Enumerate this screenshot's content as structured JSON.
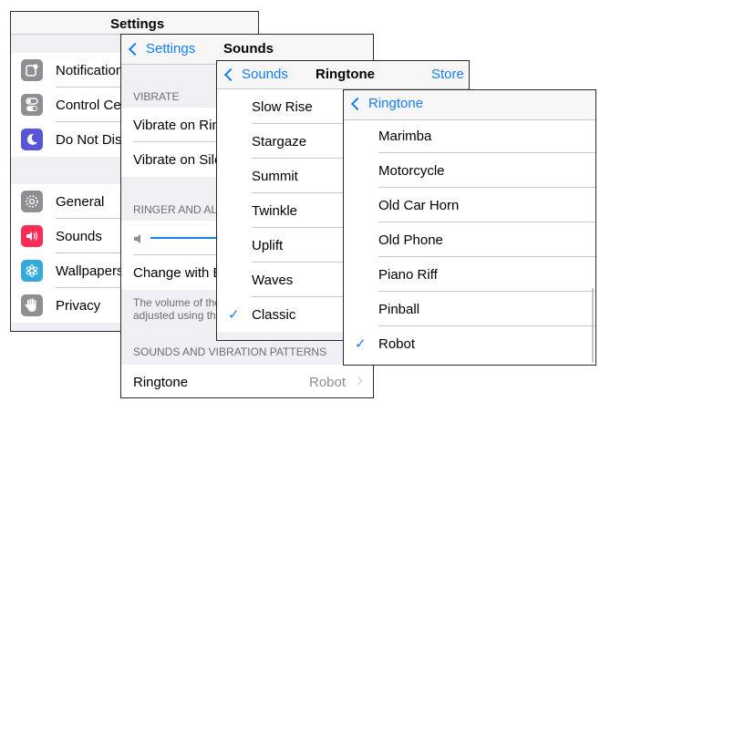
{
  "colors": {
    "accent": "#147efb",
    "background": "#efeff4"
  },
  "settings_panel": {
    "title": "Settings",
    "group1": [
      {
        "label": "Notifications",
        "icon": "notifications-icon",
        "color": "#8e8e93"
      },
      {
        "label": "Control Center",
        "icon": "toggles-icon",
        "color": "#8e8e93"
      },
      {
        "label": "Do Not Disturb",
        "icon": "moon-icon",
        "color": "#5856d6"
      }
    ],
    "group2": [
      {
        "label": "General",
        "icon": "gear-icon",
        "color": "#8e8e93"
      },
      {
        "label": "Sounds",
        "icon": "speaker-icon",
        "color": "#ff2d55"
      },
      {
        "label": "Wallpapers",
        "icon": "flower-icon",
        "color": "#34aadc"
      },
      {
        "label": "Privacy",
        "icon": "hand-icon",
        "color": "#8e8e93"
      }
    ]
  },
  "sounds_panel": {
    "back_label": "Settings",
    "title": "Sounds",
    "vibrate_header": "VIBRATE",
    "vibrate_items": [
      "Vibrate on Ring",
      "Vibrate on Silent"
    ],
    "ringer_header": "RINGER AND ALERTS",
    "ringer_volume": 0.4,
    "change_with_buttons": "Change with Buttons",
    "footer_note": [
      "The volume of the ringer and alerts can be",
      "adjusted using the volume buttons."
    ],
    "patterns_header": "SOUNDS AND VIBRATION PATTERNS",
    "ringtone_label": "Ringtone",
    "ringtone_value": "Robot"
  },
  "ringtone_panel": {
    "back_label": "Sounds",
    "title": "Ringtone",
    "store_label": "Store",
    "items": [
      "Slow Rise",
      "Stargaze",
      "Summit",
      "Twinkle",
      "Uplift",
      "Waves",
      "Classic"
    ],
    "selected": "Classic"
  },
  "classic_panel": {
    "back_label": "Ringtone",
    "items": [
      "Marimba",
      "Motorcycle",
      "Old Car Horn",
      "Old Phone",
      "Piano Riff",
      "Pinball",
      "Robot"
    ],
    "selected": "Robot"
  }
}
